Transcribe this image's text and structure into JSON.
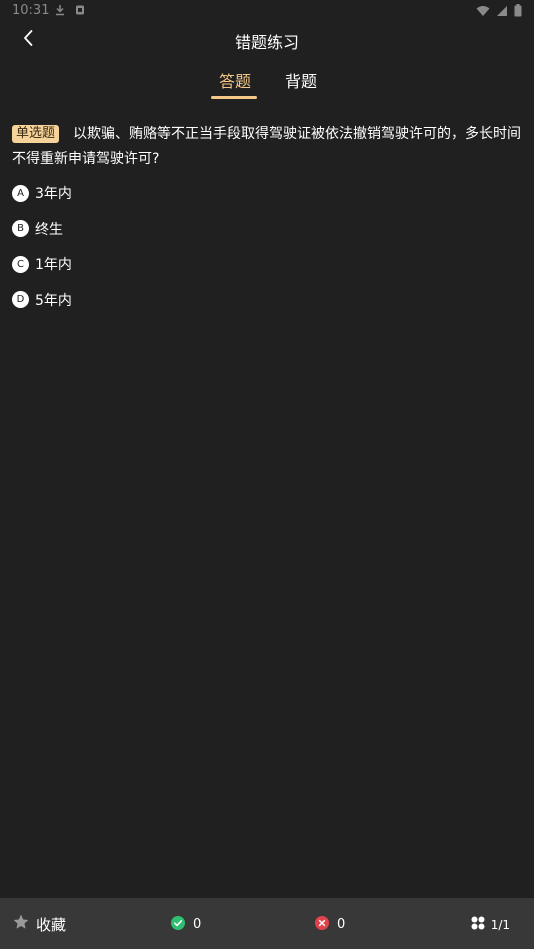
{
  "status_bar": {
    "time": "10:31"
  },
  "header": {
    "title": "错题练习"
  },
  "tabs": [
    {
      "label": "答题",
      "active": true
    },
    {
      "label": "背题",
      "active": false
    }
  ],
  "question": {
    "type_label": "单选题",
    "text": "以欺骗、贿赂等不正当手段取得驾驶证被依法撤销驾驶许可的，多长时间不得重新申请驾驶许可?"
  },
  "options": [
    {
      "letter": "A",
      "text": "3年内"
    },
    {
      "letter": "B",
      "text": "终生"
    },
    {
      "letter": "C",
      "text": "1年内"
    },
    {
      "letter": "D",
      "text": "5年内"
    }
  ],
  "bottom_bar": {
    "favorite_label": "收藏",
    "correct_count": "0",
    "wrong_count": "0",
    "progress": "1/1"
  },
  "colors": {
    "background": "#202020",
    "accent": "#f3c889",
    "badge_bg": "#f6d39a",
    "bottom_bar": "#383838",
    "correct": "#2fbf71",
    "wrong": "#e0434b"
  }
}
